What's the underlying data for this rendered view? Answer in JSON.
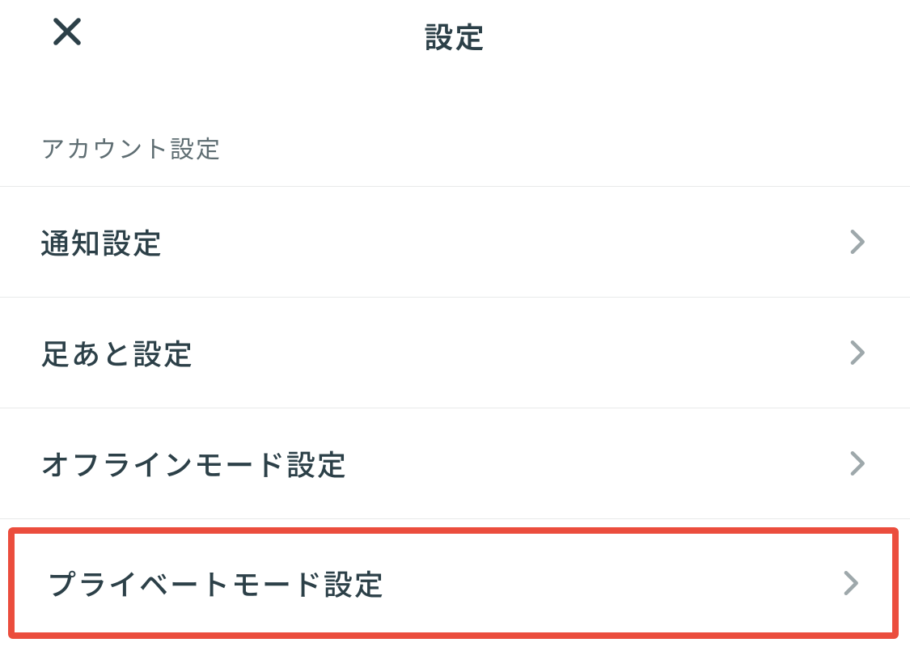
{
  "header": {
    "title": "設定"
  },
  "section": {
    "header": "アカウント設定",
    "items": [
      {
        "label": "通知設定",
        "highlighted": false
      },
      {
        "label": "足あと設定",
        "highlighted": false
      },
      {
        "label": "オフラインモード設定",
        "highlighted": false
      },
      {
        "label": "プライベートモード設定",
        "highlighted": true
      }
    ]
  }
}
